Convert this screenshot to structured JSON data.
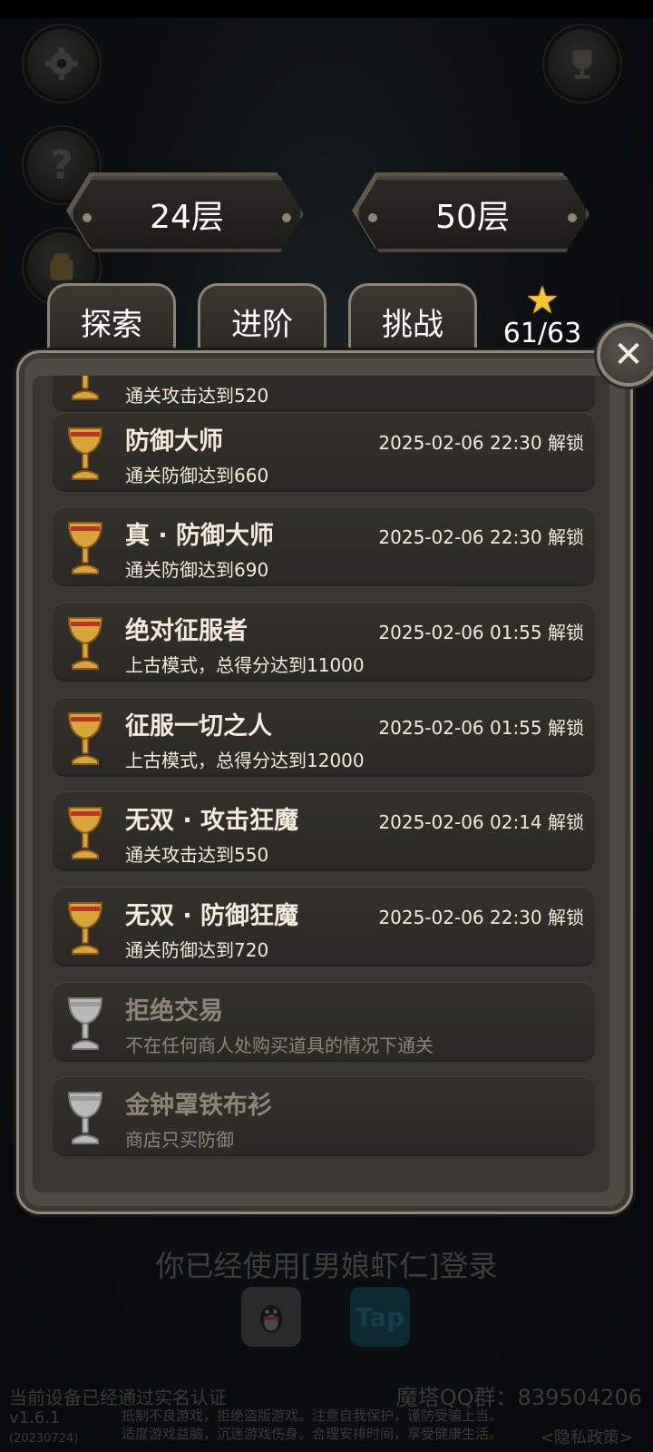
{
  "header": {
    "settings_icon": "gear-icon",
    "help_icon": "question-icon",
    "trophy_icon": "trophy-icon",
    "help_glyph": "?"
  },
  "floors": {
    "current": "24层",
    "max": "50层"
  },
  "tabs": [
    {
      "label": "探索"
    },
    {
      "label": "进阶"
    },
    {
      "label": "挑战"
    }
  ],
  "stars": {
    "icon": "star-icon",
    "count": "61/63"
  },
  "close_glyph": "✕",
  "achievements": [
    {
      "title": "",
      "date": "",
      "desc": "通关攻击达到520",
      "unlocked": true
    },
    {
      "title": "防御大师",
      "date": "2025-02-06 22:30 解锁",
      "desc": "通关防御达到660",
      "unlocked": true
    },
    {
      "title": "真 · 防御大师",
      "date": "2025-02-06 22:30 解锁",
      "desc": "通关防御达到690",
      "unlocked": true
    },
    {
      "title": "绝对征服者",
      "date": "2025-02-06 01:55 解锁",
      "desc": "上古模式，总得分达到11000",
      "unlocked": true
    },
    {
      "title": "征服一切之人",
      "date": "2025-02-06 01:55 解锁",
      "desc": "上古模式，总得分达到12000",
      "unlocked": true
    },
    {
      "title": "无双 · 攻击狂魔",
      "date": "2025-02-06 02:14 解锁",
      "desc": "通关攻击达到550",
      "unlocked": true
    },
    {
      "title": "无双 · 防御狂魔",
      "date": "2025-02-06 22:30 解锁",
      "desc": "通关防御达到720",
      "unlocked": true
    },
    {
      "title": "拒绝交易",
      "date": "",
      "desc": "不在任何商人处购买道具的情况下通关",
      "unlocked": false
    },
    {
      "title": "金钟罩铁布衫",
      "date": "",
      "desc": "商店只买防御",
      "unlocked": false
    }
  ],
  "login": {
    "text": "你已经使用[男娘虾仁]登录",
    "qq_icon": "qq-penguin-icon",
    "tap_label": "Tap"
  },
  "footer": {
    "realname": "当前设备已经通过实名认证",
    "qq_group": "魔塔QQ群：839504206",
    "version": "v1.6.1",
    "build_date": "(20230724)",
    "warning_line1": "抵制不良游戏，拒绝盗版游戏。注意自我保护，谨防受骗上当。",
    "warning_line2": "适度游戏益脑，沉迷游戏伤身。合理安排时间，享受健康生活。",
    "privacy": "<隐私政策>"
  },
  "colors": {
    "gold_cup": "#d8a53a",
    "silver_cup": "#b9b9b9",
    "star": "#f7c531",
    "panel": "#4e4b45"
  }
}
